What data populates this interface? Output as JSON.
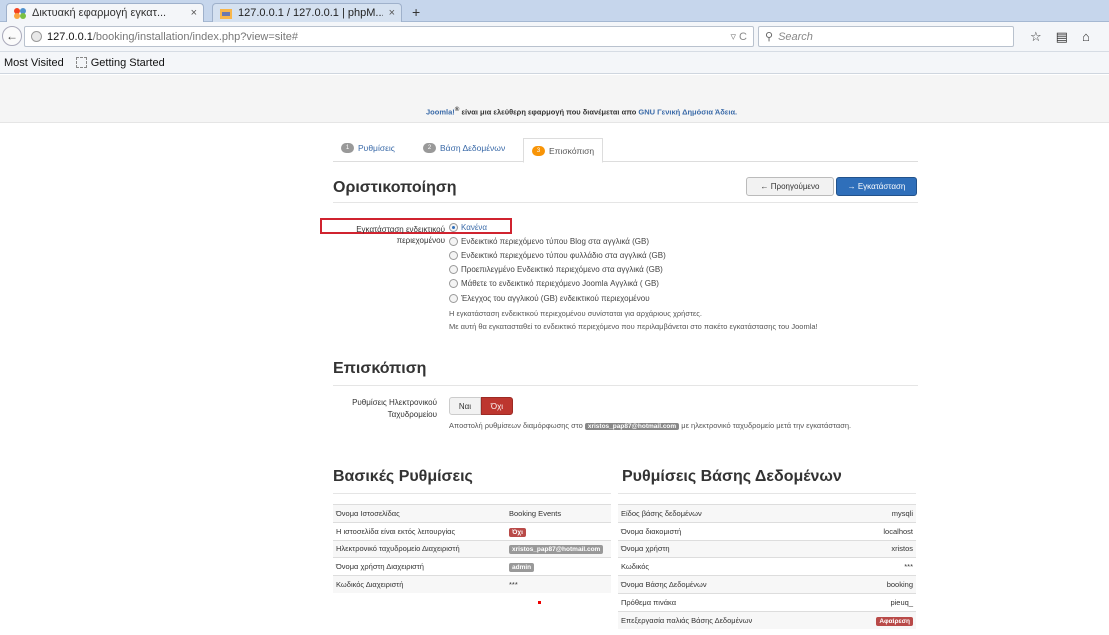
{
  "browser": {
    "tabs": [
      {
        "title": "Δικτυακή εφαρμογή εγκατ...",
        "close": "×"
      },
      {
        "title": "127.0.0.1 / 127.0.0.1 | phpM...",
        "close": "×"
      }
    ],
    "new_tab": "+",
    "back": "←",
    "url_host": "127.0.0.1",
    "url_path": "/booking/installation/index.php?view=site#",
    "url_controls": "▿ C",
    "search_placeholder": "Search",
    "bookmarks": [
      "Most Visited",
      "Getting Started"
    ]
  },
  "license": {
    "joomla": "Joomla!",
    "sup": "®",
    "text": " είναι μια ελεύθερη εφαρμογή που διανέμεται απο ",
    "link": "GNU Γενική Δημόσια Άδεια."
  },
  "steps": [
    {
      "num": "1",
      "label": "Ρυθμίσεις"
    },
    {
      "num": "2",
      "label": "Βάση Δεδομένων"
    },
    {
      "num": "3",
      "label": "Επισκόπιση"
    }
  ],
  "finalization": {
    "title": "Οριστικοποίηση",
    "prev_button": "← Προηγούμενο",
    "install_button": "→ Εγκατάσταση",
    "sample_label": "Εγκατάσταση ενδεικτικού περιεχομένου",
    "options": [
      "Κανένα",
      "Ενδεικτικό περιεχόμενο τύπου Blog στα αγγλικά (GB)",
      "Ενδεικτικό περιεχόμενο τύπου φυλλάδιο στα αγγλικά (GB)",
      "Προεπιλεγμένο Ενδεικτικό περιεχόμενο στα αγγλικά (GB)",
      "Μάθετε το ενδεικτικό περιεχόμενο Joomla Αγγλικά ( GB)",
      "Έλεγχος του αγγλικού (GB) ενδεικτικού περιεχομένου"
    ],
    "help1": "Η εγκατάσταση ενδεικτικού περιεχομένου συνίσταται για αρχάριους χρήστες.",
    "help2": "Με αυτή θα εγκατασταθεί το ενδεικτικό περιεχόμενο που περιλαμβάνεται στο πακέτο εγκατάστασης του Joomla!"
  },
  "overview": {
    "title": "Επισκόπιση",
    "email_label": "Ρυθμίσεις Ηλεκτρονικού Ταχυδρομείου",
    "yes": "Ναι",
    "no": "Όχι",
    "help_pre": "Αποστολή ρυθμίσεων διαμόρφωσης στο ",
    "help_email": "xristos_pap87@hotmail.com",
    "help_post": " με ηλεκτρονικό ταχυδρομείο μετά την εγκατάσταση."
  },
  "basic": {
    "title": "Βασικές Ρυθμίσεις",
    "rows": [
      {
        "label": "Όνομα Ιστοσελίδας",
        "value": "Booking Events"
      },
      {
        "label": "Η ιστοσελίδα είναι εκτός λειτουργίας",
        "value": "Όχι"
      },
      {
        "label": "Ηλεκτρονικό ταχυδρομείο Διαχειριστή",
        "value": "xristos_pap87@hotmail.com"
      },
      {
        "label": "Όνομα χρήστη Διαχειριστή",
        "value": "admin"
      },
      {
        "label": "Κωδικός Διαχειριστή",
        "value": "***"
      }
    ]
  },
  "database": {
    "title": "Ρυθμίσεις Βάσης Δεδομένων",
    "rows": [
      {
        "label": "Είδος βάσης δεδομένων",
        "value": "mysqli"
      },
      {
        "label": "Όνομα διακομιστή",
        "value": "localhost"
      },
      {
        "label": "Όνομα χρήστη",
        "value": "xristos"
      },
      {
        "label": "Κωδικός",
        "value": "***"
      },
      {
        "label": "Όνομα Βάσης Δεδομένων",
        "value": "booking"
      },
      {
        "label": "Πρόθεμα πινάκα",
        "value": "pieuq_"
      },
      {
        "label": "Επεξεργασία παλιάς Βάσης Δεδομένων",
        "value": "Αφαίρεση"
      }
    ]
  },
  "colors": {
    "accent": "#2f6fba",
    "danger": "#bd362f",
    "step_active": "#f89406",
    "highlight_box": "#d0232f"
  }
}
